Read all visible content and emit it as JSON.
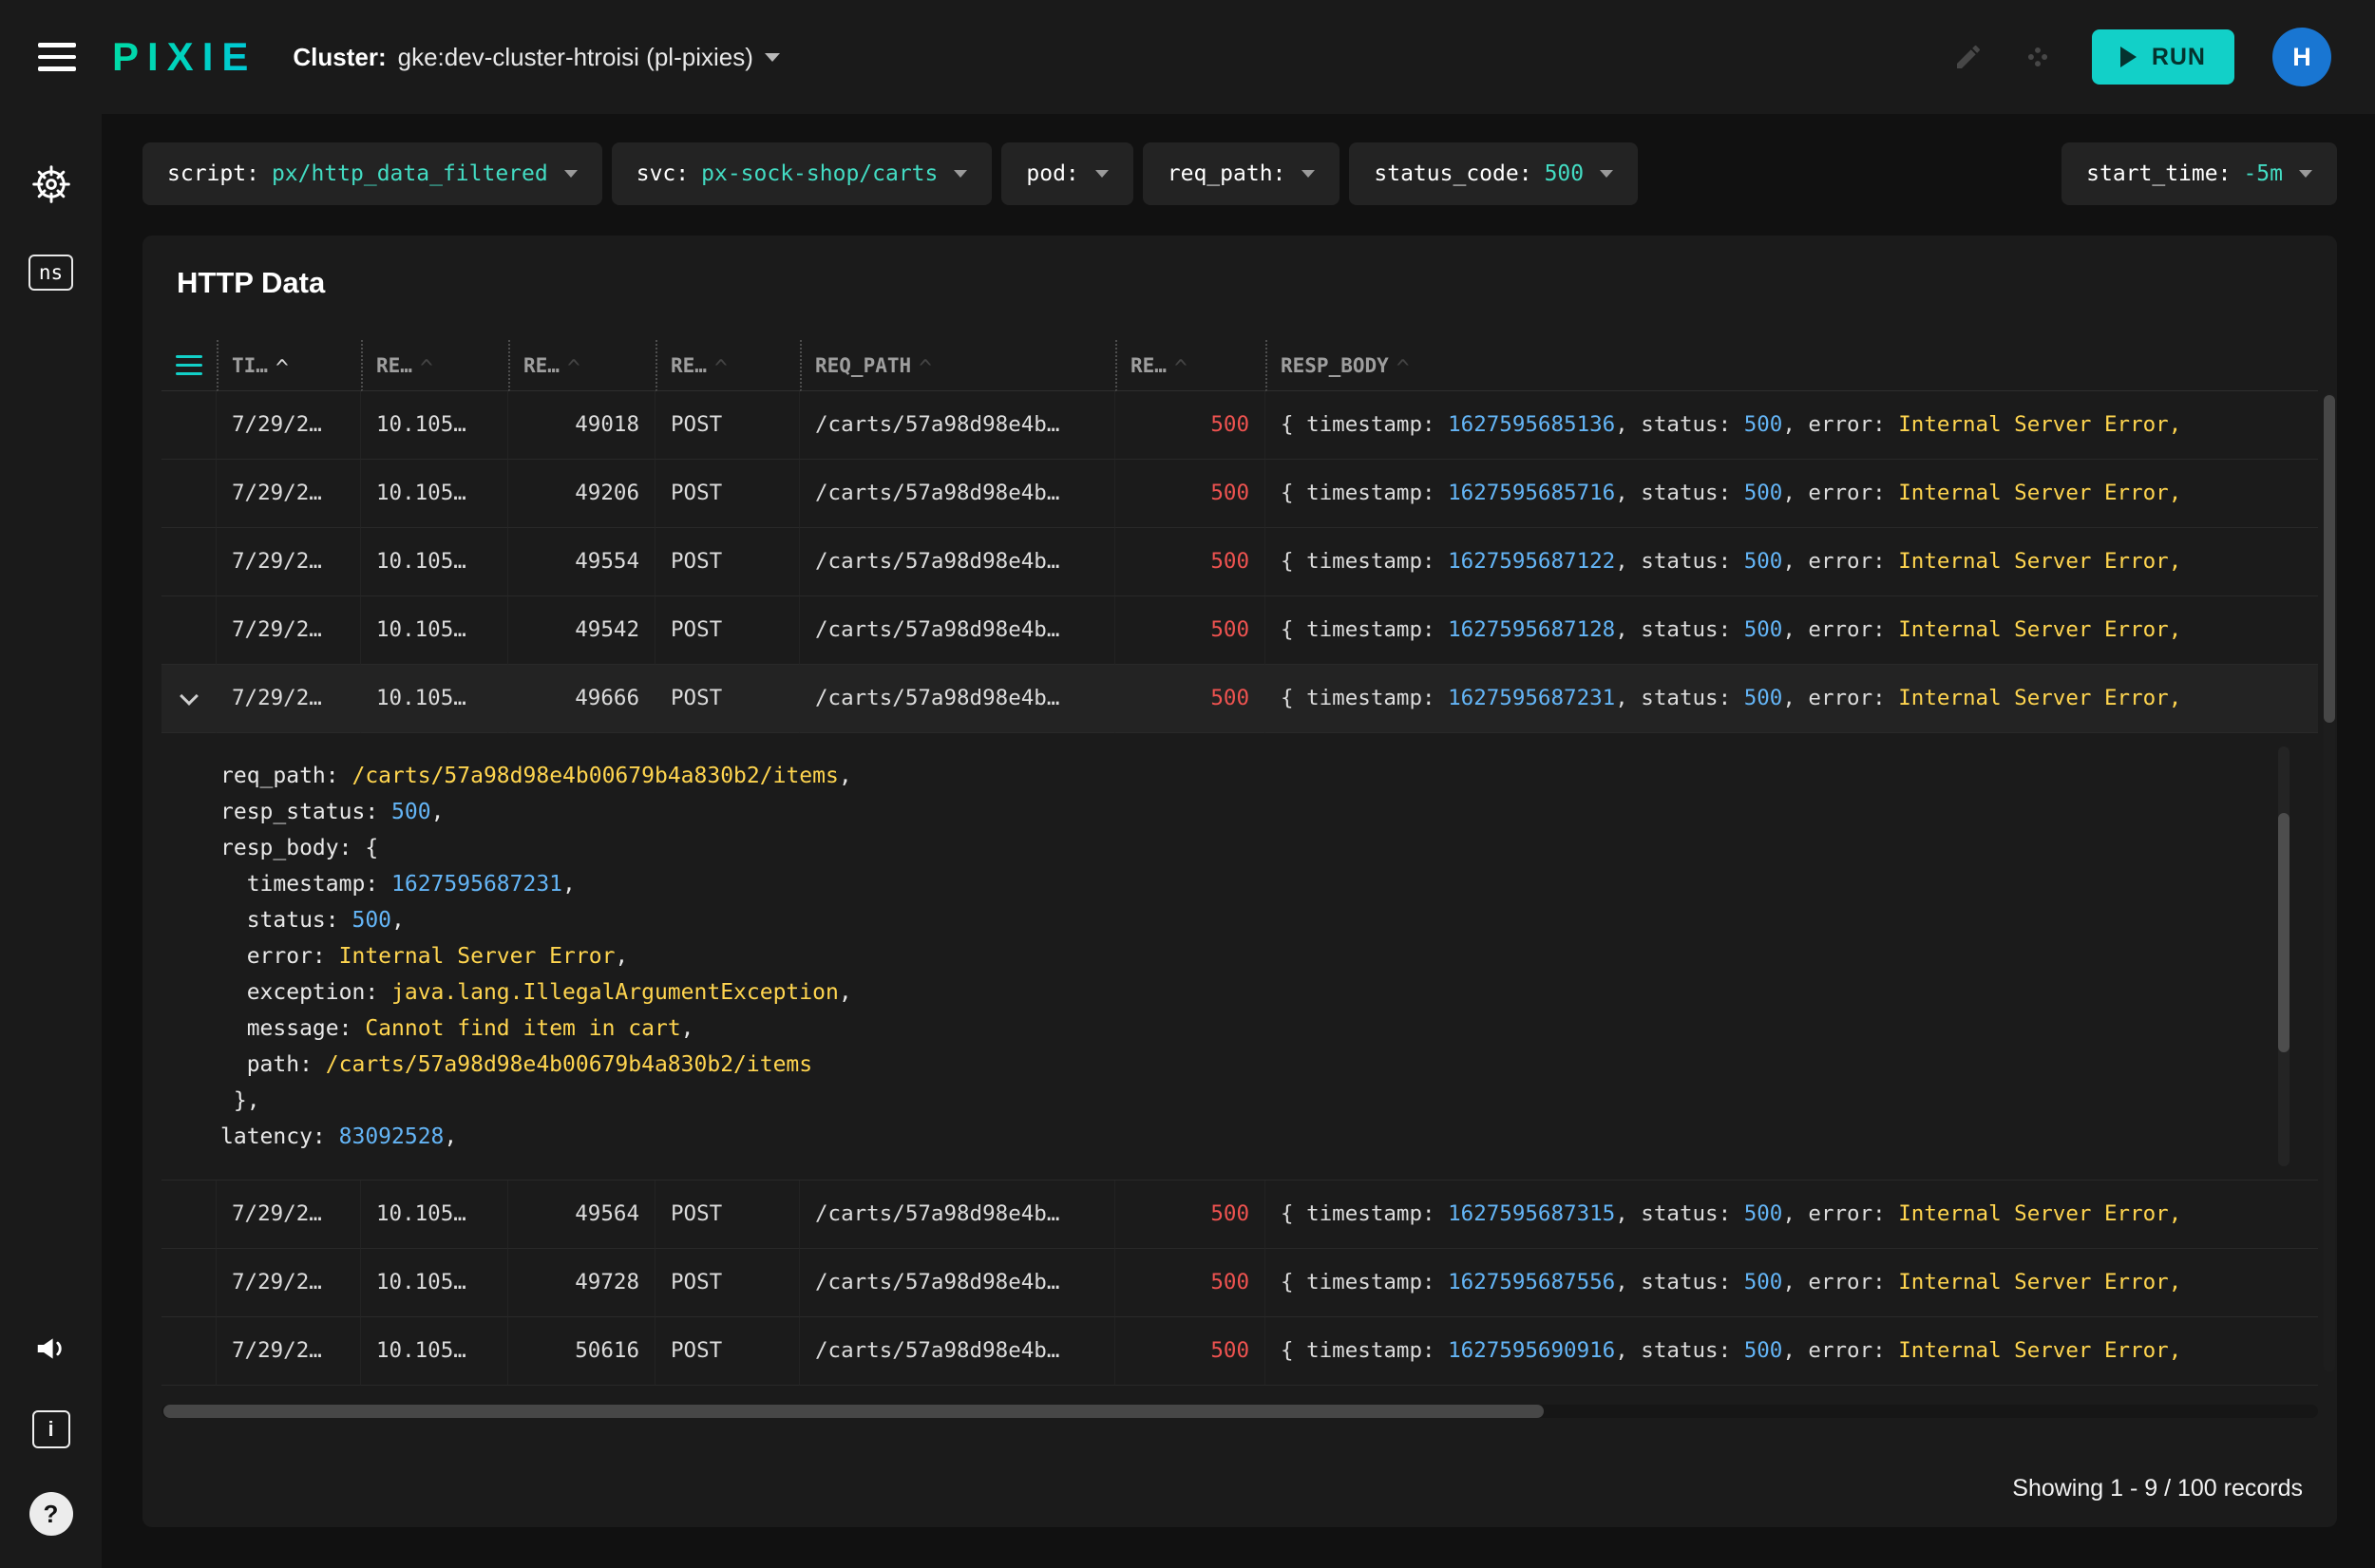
{
  "topbar": {
    "logo": "PIXIE",
    "cluster_label": "Cluster:",
    "cluster_value": "gke:dev-cluster-htroisi (pl-pixies)",
    "run_label": "RUN",
    "avatar_initial": "H"
  },
  "sidebar": {
    "ns_label": "ns",
    "info_label": "i",
    "help_label": "?",
    "icons": [
      "k8s-helm-icon",
      "namespace-icon",
      "announcement-icon",
      "info-icon",
      "help-icon"
    ]
  },
  "toolbar": {
    "pills": [
      {
        "label": "script:",
        "value": "px/http_data_filtered"
      },
      {
        "label": "svc:",
        "value": "px-sock-shop/carts"
      },
      {
        "label": "pod:",
        "value": ""
      },
      {
        "label": "req_path:",
        "value": ""
      },
      {
        "label": "status_code:",
        "value": "500"
      }
    ],
    "start_time_label": "start_time:",
    "start_time_value": "-5m"
  },
  "table": {
    "title": "HTTP Data",
    "columns": [
      {
        "label": "TI…",
        "sorted": true
      },
      {
        "label": "RE…"
      },
      {
        "label": "RE…"
      },
      {
        "label": "RE…"
      },
      {
        "label": "REQ_PATH"
      },
      {
        "label": "RE…"
      },
      {
        "label": "RESP_BODY"
      }
    ],
    "body_template": {
      "prefix": "{ timestamp: ",
      "status_label": ", status: ",
      "status_value": "500",
      "error_label": ", error: ",
      "error_value": "Internal Server Error,"
    },
    "rows": [
      {
        "time": "7/29/2…",
        "addr": "10.105…",
        "port": "49018",
        "method": "POST",
        "path": "/carts/57a98d98e4b…",
        "status": "500",
        "ts": "1627595685136"
      },
      {
        "time": "7/29/2…",
        "addr": "10.105…",
        "port": "49206",
        "method": "POST",
        "path": "/carts/57a98d98e4b…",
        "status": "500",
        "ts": "1627595685716"
      },
      {
        "time": "7/29/2…",
        "addr": "10.105…",
        "port": "49554",
        "method": "POST",
        "path": "/carts/57a98d98e4b…",
        "status": "500",
        "ts": "1627595687122"
      },
      {
        "time": "7/29/2…",
        "addr": "10.105…",
        "port": "49542",
        "method": "POST",
        "path": "/carts/57a98d98e4b…",
        "status": "500",
        "ts": "1627595687128"
      },
      {
        "time": "7/29/2…",
        "addr": "10.105…",
        "port": "49666",
        "method": "POST",
        "path": "/carts/57a98d98e4b…",
        "status": "500",
        "ts": "1627595687231",
        "expanded": true
      },
      {
        "time": "7/29/2…",
        "addr": "10.105…",
        "port": "49564",
        "method": "POST",
        "path": "/carts/57a98d98e4b…",
        "status": "500",
        "ts": "1627595687315"
      },
      {
        "time": "7/29/2…",
        "addr": "10.105…",
        "port": "49728",
        "method": "POST",
        "path": "/carts/57a98d98e4b…",
        "status": "500",
        "ts": "1627595687556"
      },
      {
        "time": "7/29/2…",
        "addr": "10.105…",
        "port": "50616",
        "method": "POST",
        "path": "/carts/57a98d98e4b…",
        "status": "500",
        "ts": "1627595690916"
      }
    ],
    "detail_lines": [
      {
        "segments": [
          {
            "text": "req_path: "
          },
          {
            "text": "/carts/57a98d98e4b00679b4a830b2/items",
            "color": "str"
          },
          {
            "text": ","
          }
        ]
      },
      {
        "segments": [
          {
            "text": "resp_status: "
          },
          {
            "text": "500",
            "color": "num"
          },
          {
            "text": ","
          }
        ]
      },
      {
        "segments": [
          {
            "text": "resp_body: {"
          }
        ]
      },
      {
        "segments": [
          {
            "text": "  timestamp: "
          },
          {
            "text": "1627595687231",
            "color": "num"
          },
          {
            "text": ","
          }
        ]
      },
      {
        "segments": [
          {
            "text": "  status: "
          },
          {
            "text": "500",
            "color": "num"
          },
          {
            "text": ","
          }
        ]
      },
      {
        "segments": [
          {
            "text": "  error: "
          },
          {
            "text": "Internal Server Error",
            "color": "str"
          },
          {
            "text": ","
          }
        ]
      },
      {
        "segments": [
          {
            "text": "  exception: "
          },
          {
            "text": "java.lang.IllegalArgumentException",
            "color": "str"
          },
          {
            "text": ","
          }
        ]
      },
      {
        "segments": [
          {
            "text": "  message: "
          },
          {
            "text": "Cannot find item in cart",
            "color": "str"
          },
          {
            "text": ","
          }
        ]
      },
      {
        "segments": [
          {
            "text": "  path: "
          },
          {
            "text": "/carts/57a98d98e4b00679b4a830b2/items",
            "color": "str"
          }
        ]
      },
      {
        "segments": [
          {
            "text": " },"
          }
        ]
      },
      {
        "segments": [
          {
            "text": "latency: "
          },
          {
            "text": "83092528",
            "color": "num"
          },
          {
            "text": ","
          }
        ]
      }
    ],
    "footer": "Showing 1 - 9 / 100 records"
  },
  "colors": {
    "accent": "#12d0c8",
    "accent_text": "#43dcc3",
    "status_red": "#ef5350",
    "number_blue": "#64b5f6",
    "string_yellow": "#ffd54f",
    "avatar_blue": "#1976d2",
    "logo_green": "#00dba6",
    "logo_teal": "#00c8d8"
  }
}
